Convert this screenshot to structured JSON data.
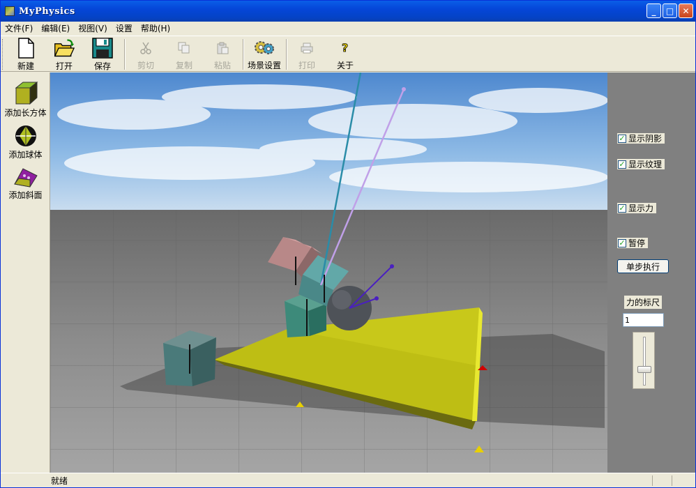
{
  "window": {
    "title": "MyPhysics"
  },
  "menu": [
    {
      "label": "文件(F)"
    },
    {
      "label": "编辑(E)"
    },
    {
      "label": "视图(V)"
    },
    {
      "label": "设置"
    },
    {
      "label": "帮助(H)"
    }
  ],
  "toolbar": {
    "new": "新建",
    "open": "打开",
    "save": "保存",
    "cut": "剪切",
    "copy": "复制",
    "paste": "粘贴",
    "scene_settings": "场景设置",
    "print": "打印",
    "about": "关于"
  },
  "left_panel": {
    "add_box": "添加长方体",
    "add_sphere": "添加球体",
    "add_slope": "添加斜面"
  },
  "right_panel": {
    "show_shadow": "显示阴影",
    "show_texture": "显示纹理",
    "show_force": "显示力",
    "pause": "暂停",
    "step": "单步执行",
    "force_scale_label": "力的标尺",
    "force_scale_value": "1",
    "force_scale_slider_fraction": 0.7
  },
  "status": {
    "text": "就绪"
  },
  "colors": {
    "titlebar": "#0546d8",
    "sky": "#6fa4dc",
    "slope": "#c8c81a",
    "check": "#21a121"
  }
}
